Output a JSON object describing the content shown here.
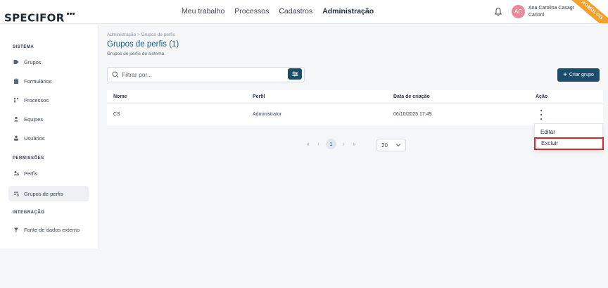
{
  "header": {
    "logo": "SPECIFOR",
    "nav": [
      "Meu trabalho",
      "Processos",
      "Cadastros",
      "Administração"
    ],
    "active_nav": "Administração",
    "avatar_initials": "AC",
    "user_name": "Ana Carolina Casagr",
    "user_name_line2": "Carioni",
    "env_badge": "HOMOLOG"
  },
  "sidebar": {
    "sections": [
      {
        "title": "SISTEMA",
        "items": [
          "Grupos",
          "Formulários",
          "Processos",
          "Equipes",
          "Usuários"
        ]
      },
      {
        "title": "PERMISSÕES",
        "items": [
          "Perfis",
          "Grupos de perfis"
        ]
      },
      {
        "title": "INTEGRAÇÃO",
        "items": [
          "Fonte de dados externo"
        ]
      }
    ],
    "active_item": "Grupos de perfis"
  },
  "main": {
    "breadcrumb": "Administração  >  Grupos de perfis",
    "title": "Grupos de perfis (1)",
    "subtitle": "Grupos de perfis do sistema",
    "search_placeholder": "Filtrar por...",
    "new_button": "Criar grupo",
    "table": {
      "columns": [
        "Nome",
        "Perfil",
        "Data de criação",
        "Ação"
      ],
      "rows": [
        {
          "name": "CS",
          "profile": "Administrator",
          "created": "06/10/2025 17:49"
        }
      ]
    },
    "pagination": {
      "first": "«",
      "prev": "‹",
      "current": "1",
      "next": "›",
      "last": "»",
      "page_size": "20"
    },
    "row_menu": {
      "items": [
        "Editar",
        "Excluir"
      ],
      "highlighted": "Excluir"
    }
  }
}
